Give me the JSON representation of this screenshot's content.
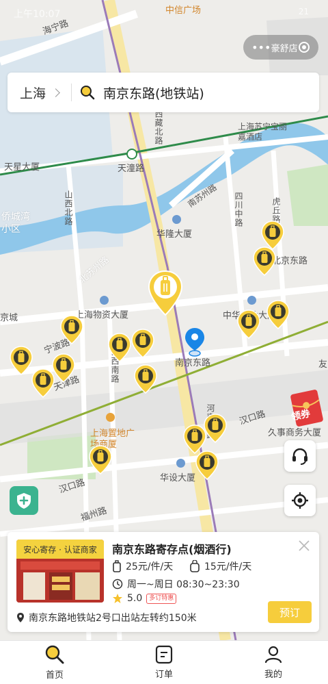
{
  "status_bar": {
    "time": "上午10:07",
    "battery": "21"
  },
  "top_pill": {
    "dots": "•••",
    "partial_label": "豪舒店"
  },
  "search": {
    "city": "上海",
    "query": "南京东路(地铁站)"
  },
  "map_labels": {
    "haining_rd": "海宁路",
    "zhongxin": "中信广场",
    "xizang_n": "西藏北路",
    "suning": "上海苏宁宝丽嘉酒店",
    "tianxing": "天星大厦",
    "tiantong_rd": "天潼路",
    "qiaocheng": "侨城湾小区",
    "shanxi_n": "山西北路",
    "nansuzhou": "南苏州路",
    "sichuan_mid": "四川中路",
    "huqiu": "虎丘路",
    "beisuzhou": "北苏州路",
    "hualong": "华隆大厦",
    "beijing_e": "北京东路",
    "jingcheng": "京城",
    "wuzi": "上海物资大厦",
    "zhonghua": "中华企业大厦",
    "ningbo": "宁波路",
    "tianjin": "天津路",
    "shanxi_s": "山西南路",
    "nanjing_e": "南京东路",
    "zhidi": "上海置地广场商厦",
    "henan": "河南中路",
    "hankou": "汉口路",
    "hankou2": "汉口路",
    "jiushi": "久事商务大厦",
    "fuzhou": "福州路",
    "huashe": "华设大厦",
    "you": "友"
  },
  "coupon": {
    "label": "领券"
  },
  "shop_card": {
    "tag": "安心寄存 · 认证商家",
    "title": "南京东路寄存点(烟酒行)",
    "price_luggage": "25元/件/天",
    "price_bag": "15元/件/天",
    "hours": "周一~周日 08:30~23:30",
    "rating": "5.0",
    "discount_badge": "多订特惠",
    "address": "南京东路地铁站2号口出站左转约150米",
    "book_label": "预订"
  },
  "tabs": [
    {
      "label": "首页"
    },
    {
      "label": "订单"
    },
    {
      "label": "我的"
    }
  ],
  "colors": {
    "accent": "#f6cd3c",
    "river": "#8fc7ea",
    "metro_line2": "#2e8b4a",
    "metro_purple": "#9b7bb8",
    "road_yellow": "#f7e7a4"
  }
}
